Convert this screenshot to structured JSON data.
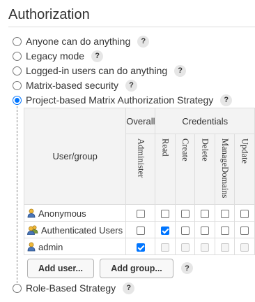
{
  "section": {
    "title": "Authorization"
  },
  "strategies": [
    {
      "label": "Anyone can do anything",
      "checked": false
    },
    {
      "label": "Legacy mode",
      "checked": false
    },
    {
      "label": "Logged-in users can do anything",
      "checked": false
    },
    {
      "label": "Matrix-based security",
      "checked": false
    },
    {
      "label": "Project-based Matrix Authorization Strategy",
      "checked": true
    },
    {
      "label": "Role-Based Strategy",
      "checked": false
    }
  ],
  "help_glyph": "?",
  "matrix": {
    "user_group_header": "User/group",
    "groups": [
      "Overall",
      "Credentials"
    ],
    "permissions": [
      "Administer",
      "Read",
      "Create",
      "Delete",
      "ManageDomains",
      "Update"
    ],
    "rows": [
      {
        "name": "Anonymous",
        "icon": "person-icon",
        "checks": [
          false,
          false,
          false,
          false,
          false,
          false
        ],
        "disabled": [
          false,
          false,
          false,
          false,
          false,
          false
        ]
      },
      {
        "name": "Authenticated Users",
        "icon": "group-icon",
        "checks": [
          false,
          true,
          false,
          false,
          false,
          false
        ],
        "disabled": [
          false,
          false,
          false,
          false,
          false,
          false
        ]
      },
      {
        "name": "admin",
        "icon": "person-icon",
        "checks": [
          true,
          false,
          false,
          false,
          false,
          false
        ],
        "disabled": [
          false,
          true,
          true,
          true,
          true,
          true
        ]
      }
    ]
  },
  "buttons": {
    "add_user": "Add user...",
    "add_group": "Add group..."
  },
  "colors": {
    "accent": "#0075ff",
    "help_bg": "#e6e6e6",
    "header_bg": "#f3f3f3"
  }
}
